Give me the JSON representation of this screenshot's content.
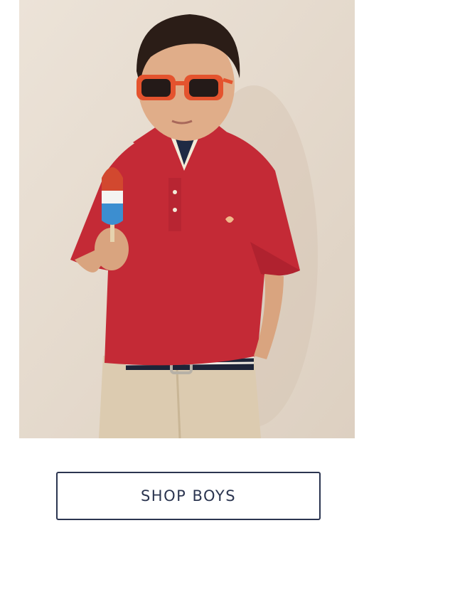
{
  "hero": {
    "image_subject": "boy-in-red-polo-with-popsicle",
    "colors": {
      "background": "#e9dfd3",
      "polo": "#c42a36",
      "khaki": "#dccbb0",
      "sunglasses": "#e4532e"
    }
  },
  "cta": {
    "label": "SHOP BOYS",
    "color": "#2b3550"
  }
}
